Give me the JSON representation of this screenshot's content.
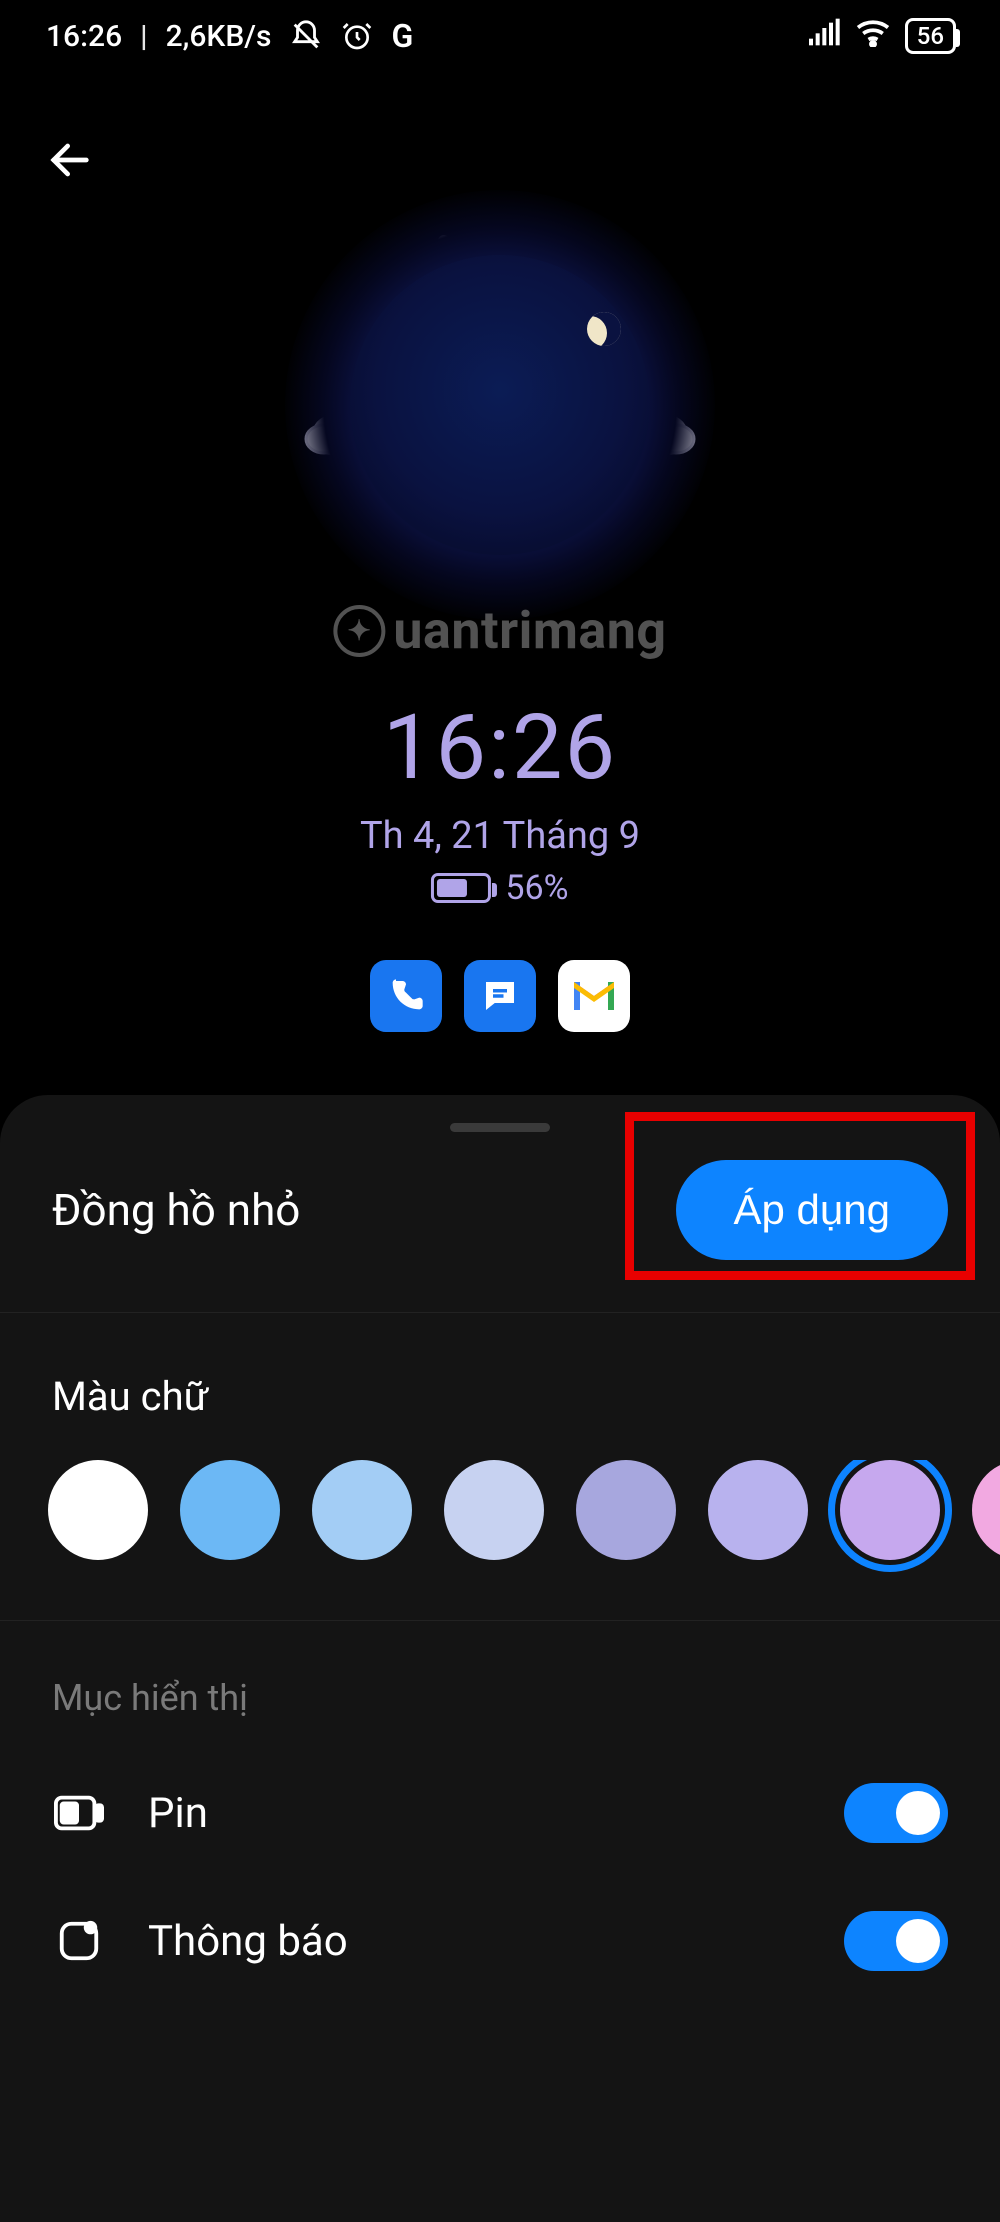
{
  "status": {
    "time": "16:26",
    "speed": "2,6KB/s",
    "battery_pct": "56",
    "muted_icon": "bell-slash",
    "alarm_icon": "alarm",
    "google_icon": "G"
  },
  "preview": {
    "watermark": "uantrimang",
    "clock_time": "16:26",
    "clock_date": "Th 4, 21 Tháng 9",
    "battery_text": "56%",
    "apps": [
      "phone",
      "messages",
      "gmail"
    ]
  },
  "sheet": {
    "title": "Đồng hồ nhỏ",
    "apply_label": "Áp dụng",
    "text_color_label": "Màu chữ",
    "colors": [
      {
        "hex": "#ffffff",
        "selected": false
      },
      {
        "hex": "#6cb8f5",
        "selected": false
      },
      {
        "hex": "#a3cdf5",
        "selected": false
      },
      {
        "hex": "#c7d2f1",
        "selected": false
      },
      {
        "hex": "#a7a7de",
        "selected": false
      },
      {
        "hex": "#b8b2ee",
        "selected": false
      },
      {
        "hex": "#c6a8ee",
        "selected": true
      },
      {
        "hex": "#f2a9e1",
        "selected": false
      }
    ],
    "display_section_label": "Mục hiển thị",
    "items": [
      {
        "key": "pin",
        "label": "Pin",
        "icon": "battery-icon",
        "enabled": true
      },
      {
        "key": "notif",
        "label": "Thông báo",
        "icon": "notification-icon",
        "enabled": true
      }
    ]
  }
}
